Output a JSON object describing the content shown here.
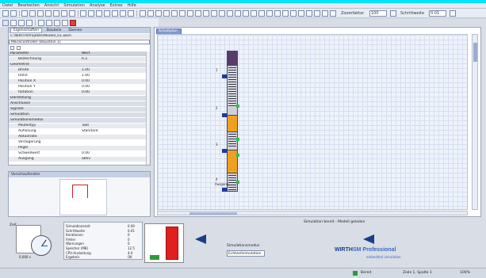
{
  "menu": [
    "Datei",
    "Bearbeiten",
    "Ansicht",
    "Simulation",
    "Analyse",
    "Extras",
    "Hilfe"
  ],
  "toolbar": {
    "zoom_label": "Zoomfaktor",
    "zoom_value": "100",
    "step_label": "Schrittweite",
    "step_value": "0.01"
  },
  "left_panel": {
    "tabs": [
      "Eigenschaften",
      "Bauteile",
      "Ebenen"
    ],
    "path": "C:\\WIRTH\\Projekte\\Modell_01.wsm",
    "selected": "Mikrocontroller (Baustein 1)",
    "header": {
      "name": "Parameter",
      "value": "Wert"
    },
    "rows": [
      {
        "name": "Bezeichnung",
        "value": "IC1",
        "type": "grey"
      },
      {
        "name": "Geometrie",
        "value": "",
        "type": "cat"
      },
      {
        "name": "Breite",
        "value": "1.00",
        "type": "grey"
      },
      {
        "name": "Höhe",
        "value": "1.00",
        "type": ""
      },
      {
        "name": "Position X",
        "value": "0.00",
        "type": "grey"
      },
      {
        "name": "Position Y",
        "value": "0.00",
        "type": ""
      },
      {
        "name": "Rotation",
        "value": "0.00",
        "type": "grey"
      },
      {
        "name": "Darstellung",
        "value": "",
        "type": "cat"
      },
      {
        "name": "Anschlüsse",
        "value": "",
        "type": "cat"
      },
      {
        "name": "Signale",
        "value": "",
        "type": "cat"
      },
      {
        "name": "Simulation",
        "value": "",
        "type": "cat"
      },
      {
        "name": "Simulationsmodus",
        "value": "",
        "type": "cat"
      },
      {
        "name": "Modelltyp",
        "value": "Takt",
        "type": "grey"
      },
      {
        "name": "Auflösung",
        "value": "Standard",
        "type": ""
      },
      {
        "name": "Abtastrate",
        "value": "",
        "type": "grey"
      },
      {
        "name": "Verzögerung",
        "value": "",
        "type": ""
      },
      {
        "name": "Pegel",
        "value": "",
        "type": "grey"
      },
      {
        "name": "Schwellwert",
        "value": "0.00",
        "type": ""
      },
      {
        "name": "Ausgang",
        "value": "aktiv",
        "type": "grey"
      }
    ]
  },
  "small_panel": {
    "title": "Vorschaufenster"
  },
  "main": {
    "tab": "Schaltplan",
    "pin_labels": [
      "1",
      "2",
      "3",
      "4",
      "Ausgang"
    ],
    "status_message": "Simulation bereit - Modell geladen"
  },
  "bottom": {
    "gauge_label": "Zeit",
    "gauge_value": "0.000 s",
    "table": [
      {
        "name": "Simulationszeit",
        "value": "0.00"
      },
      {
        "name": "Schrittweite",
        "value": "0.01"
      },
      {
        "name": "Iterationen",
        "value": "0"
      },
      {
        "name": "Fehler",
        "value": "0"
      },
      {
        "name": "Warnungen",
        "value": "0"
      },
      {
        "name": "Speicher (MB)",
        "value": "12.5"
      },
      {
        "name": "CPU-Auslastung",
        "value": "4.0"
      },
      {
        "name": "Ergebnis",
        "value": "OK"
      }
    ],
    "bar_green_value": 0.14,
    "bar_red_value": 0.95,
    "model_label": "Simulationsmodus",
    "model_select": "Echtzeitsimulation",
    "logo_main": "WIRTH",
    "logo_sub": "SM Professional",
    "logo_tagline": "embedded simulation"
  },
  "statusbar": {
    "left": "Bereit",
    "mid": "Zeile 1, Spalte 1",
    "right": "100%"
  },
  "colors": {
    "title_bar": "#00e5ff",
    "accent": "#1a3c8a",
    "bar_red": "#e02020",
    "bar_green": "#2a9a3a",
    "component_orange": "#f0a020"
  }
}
